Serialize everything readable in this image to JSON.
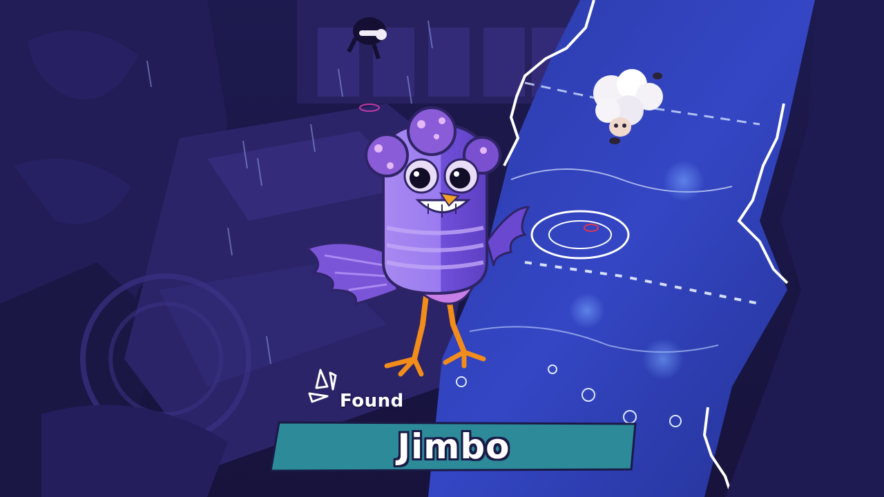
{
  "notification": {
    "prefix": "Found",
    "character_name": "Jimbo"
  },
  "icons": {
    "found_icon": "sparkle-burst-icon"
  },
  "characters": {
    "main": "purple-bird-character",
    "companion": "white-sheep-character",
    "distant": "dark-figure-character"
  },
  "colors": {
    "banner": "#2d8a99",
    "banner_border": "#1a1a46",
    "text": "#ffffff",
    "bird_body": "#8e6be8",
    "bird_dots": "#c08ae8",
    "beak": "#f4a12a",
    "legs": "#f28c1a",
    "background": "#1e1a4e",
    "water": "#2e3cb8"
  }
}
